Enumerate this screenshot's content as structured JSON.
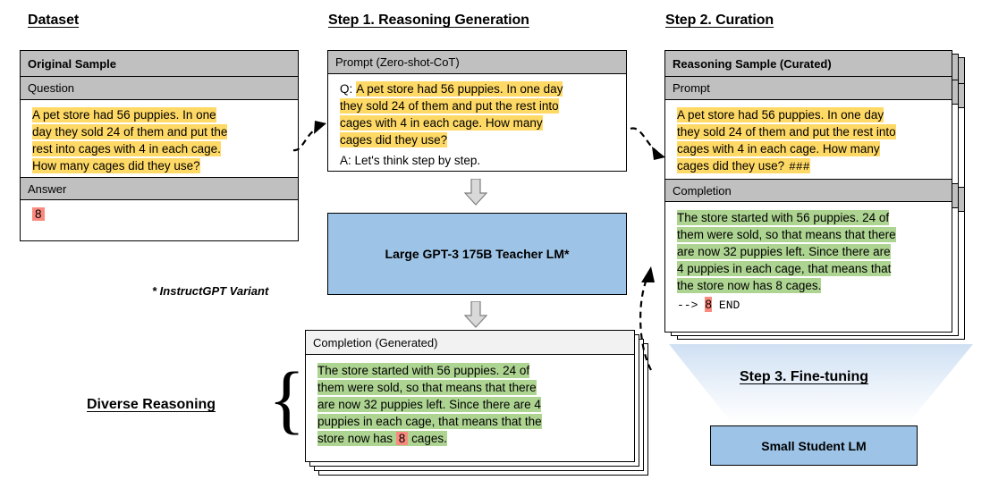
{
  "columns": {
    "dataset_title": "Dataset",
    "step1_title": "Step 1. Reasoning Generation",
    "step2_title": "Step 2. Curation",
    "step3_title": "Step 3. Fine-tuning"
  },
  "dataset_card": {
    "header": "Original Sample",
    "question_label": "Question",
    "question_lines": [
      "A pet store had 56 puppies. In one",
      "day they sold 24 of them and put the",
      "rest into cages with 4 in each cage.",
      "How many cages did they use?"
    ],
    "answer_label": "Answer",
    "answer_value": "8"
  },
  "prompt_card": {
    "header": "Prompt (Zero-shot-CoT)",
    "q_prefix": "Q:",
    "q_lines": [
      "A pet store had 56 puppies. In one day",
      "they sold 24 of them and put the rest into",
      "cages with 4 in each cage. How many",
      "cages did they use?"
    ],
    "a_line": "A: Let's think step by step."
  },
  "teacher_box": {
    "label": "Large GPT-3 175B Teacher LM*"
  },
  "footnote": "* InstructGPT Variant",
  "diverse_label": "Diverse Reasoning",
  "completion_card": {
    "header": "Completion (Generated)",
    "lines": [
      "The store started with 56 puppies. 24 of",
      "them were sold, so that means that there",
      "are now 32 puppies left.  Since there are 4",
      "puppies in each cage, that means that the"
    ],
    "last_line_pre": "store now has ",
    "last_line_value": "8",
    "last_line_post": " cages."
  },
  "curated_card": {
    "header": "Reasoning Sample (Curated)",
    "prompt_label": "Prompt",
    "prompt_lines": [
      "A pet store had 56 puppies. In one day",
      "they sold 24 of them and put the rest into",
      "cages with 4 in each cage. How many"
    ],
    "prompt_last_line": "cages did they use?",
    "prompt_marker": "###",
    "completion_label": "Completion",
    "completion_lines": [
      "The store started with 56 puppies. 24 of",
      "them were sold, so that means that there",
      "are now 32 puppies left.  Since there are",
      "4 puppies in each cage, that means that",
      "the store now has 8 cages."
    ],
    "end_arrow": "-->",
    "end_value": "8",
    "end_token": "END"
  },
  "student_box": {
    "label": "Small Student LM"
  },
  "colors": {
    "highlight_yellow": "#ffd966",
    "highlight_green": "#aed492",
    "highlight_pink": "#fa8a7e",
    "process_blue": "#9dc3e6",
    "header_gray": "#c0c0c0",
    "header_light": "#f2f2f2"
  }
}
